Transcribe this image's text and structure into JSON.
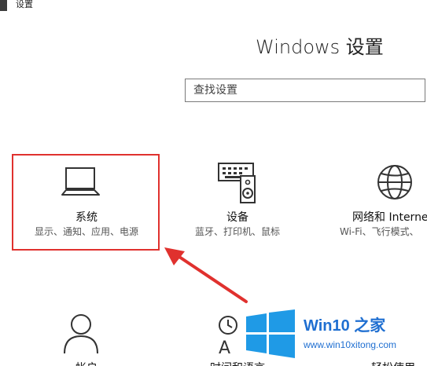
{
  "window": {
    "title": "设置"
  },
  "header": {
    "title": "Windows 设置"
  },
  "search": {
    "placeholder": "查找设置"
  },
  "tiles": [
    {
      "icon": "laptop-icon",
      "name": "系统",
      "desc": "显示、通知、应用、电源"
    },
    {
      "icon": "keyboard-speaker-icon",
      "name": "设备",
      "desc": "蓝牙、打印机、鼠标"
    },
    {
      "icon": "globe-icon",
      "name": "网络和 Interne",
      "desc": "Wi-Fi、飞行模式、"
    },
    {
      "icon": "person-icon",
      "name": "帐户",
      "desc": ""
    },
    {
      "icon": "clock-language-icon",
      "name": "时间和语言",
      "desc": ""
    },
    {
      "icon": "ease-of-access-icon",
      "name": "轻松使用",
      "desc": ""
    }
  ],
  "watermark": {
    "brand": "Win10 之家",
    "url": "www.win10xitong.com"
  },
  "colors": {
    "highlight": "#e0312e",
    "arrow": "#e0312e",
    "brand_blue": "#1f6fd1"
  }
}
